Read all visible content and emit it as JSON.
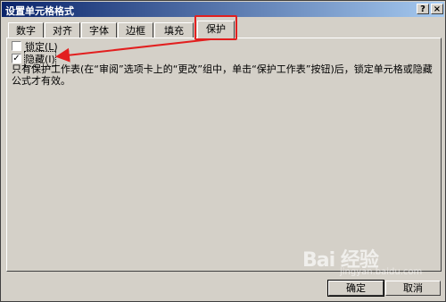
{
  "window": {
    "title": "设置单元格格式",
    "help_icon": "?",
    "close_icon": "×"
  },
  "tabs": [
    {
      "label": "数字"
    },
    {
      "label": "对齐"
    },
    {
      "label": "字体"
    },
    {
      "label": "边框"
    },
    {
      "label": "填充"
    },
    {
      "label": "保护",
      "active": true
    }
  ],
  "protection": {
    "locked_label": "锁定(L)",
    "locked_checked": false,
    "hidden_label": "隐藏(I)",
    "hidden_checked": true,
    "description": "只有保护工作表(在“审阅”选项卡上的“更改”组中，单击“保护工作表”按钮)后，锁定单元格或隐藏公式才有效。"
  },
  "watermark": {
    "brand": "Bai 经验",
    "url": "jingyan.baidu.com"
  },
  "buttons": {
    "ok": "确定",
    "cancel": "取消"
  },
  "colors": {
    "annotation_red": "#e21f1f",
    "titlebar_start": "#0a246a",
    "dialog_bg": "#d4d0c8"
  }
}
